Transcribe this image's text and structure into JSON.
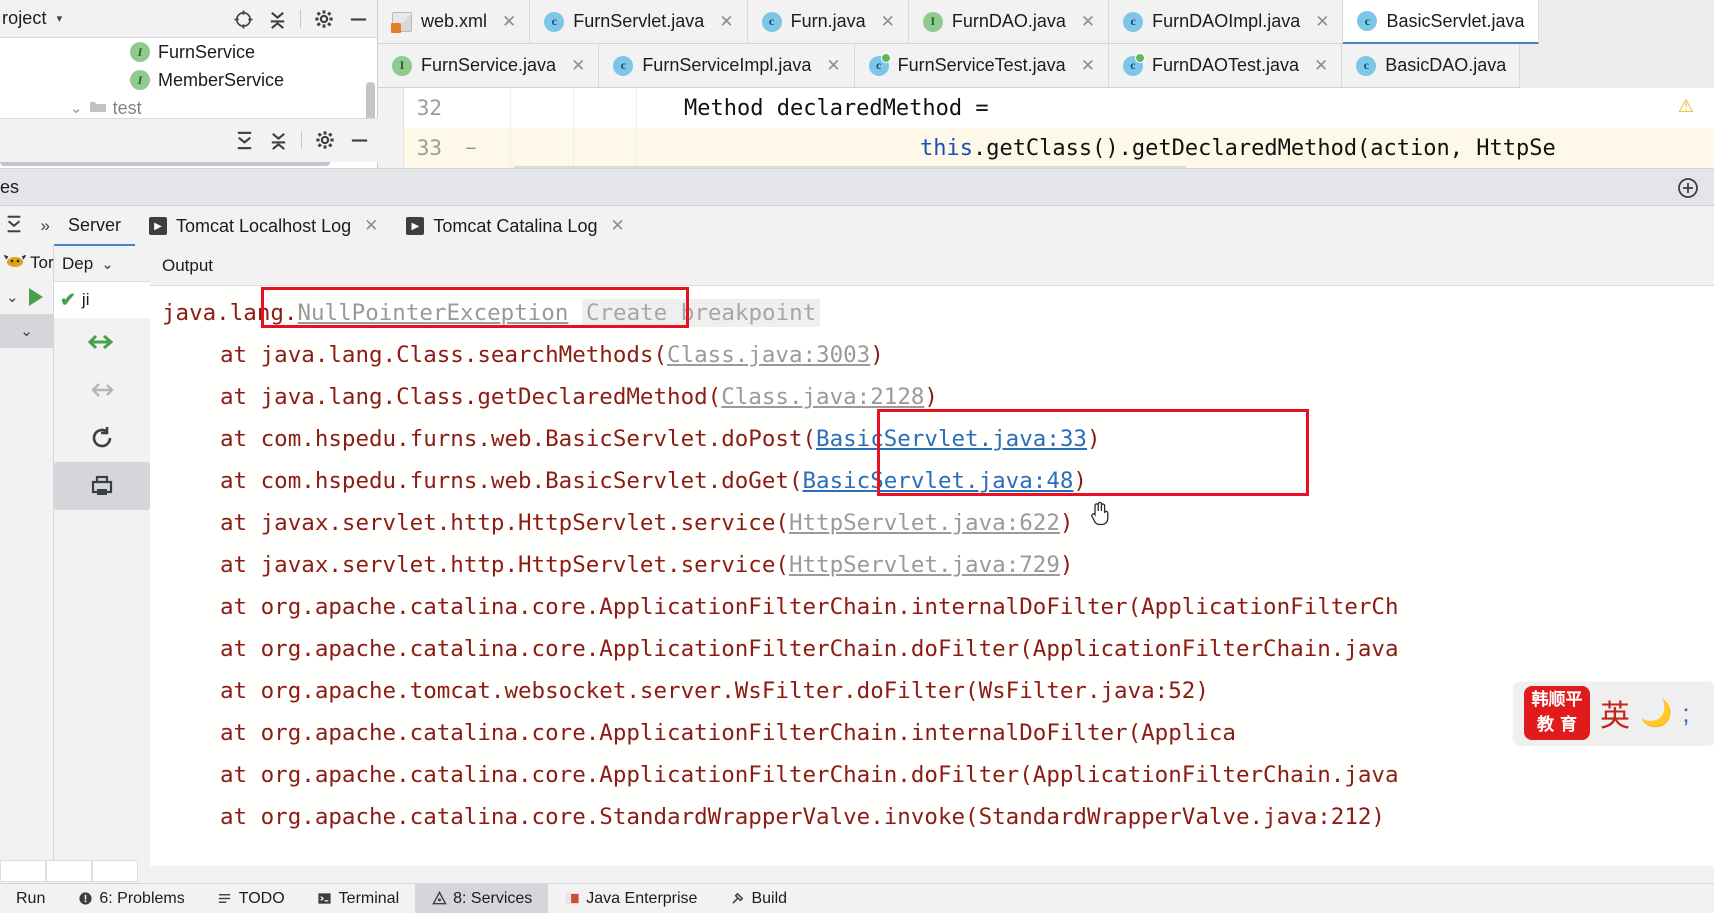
{
  "project_panel": {
    "title": "roject",
    "caret": "▾",
    "icons": [
      "locate-icon",
      "collapse-all-icon",
      "settings-gear-icon",
      "minimize-icon"
    ],
    "tree_items": [
      {
        "label": "FurnService",
        "icon": "interface-icon"
      },
      {
        "label": "MemberService",
        "icon": "interface-icon"
      },
      {
        "label": "test",
        "icon": "folder-icon"
      }
    ]
  },
  "structure_panel": {
    "icons": [
      "expand-all-icon",
      "collapse-all-icon",
      "settings-gear-icon",
      "minimize-icon"
    ]
  },
  "editor_tabs": {
    "row1": [
      {
        "label": "web.xml",
        "icon": "xml-file-icon",
        "active": false,
        "closable": true
      },
      {
        "label": "FurnServlet.java",
        "icon": "class-icon",
        "active": false,
        "closable": true
      },
      {
        "label": "Furn.java",
        "icon": "class-icon",
        "active": false,
        "closable": true
      },
      {
        "label": "FurnDAO.java",
        "icon": "interface-icon",
        "active": false,
        "closable": true
      },
      {
        "label": "FurnDAOImpl.java",
        "icon": "class-icon",
        "active": false,
        "closable": true
      },
      {
        "label": "BasicServlet.java",
        "icon": "class-icon",
        "active": true,
        "closable": false
      }
    ],
    "row2": [
      {
        "label": "FurnService.java",
        "icon": "interface-icon",
        "active": false,
        "closable": true
      },
      {
        "label": "FurnServiceImpl.java",
        "icon": "class-icon",
        "active": false,
        "closable": true
      },
      {
        "label": "FurnServiceTest.java",
        "icon": "test-class-icon",
        "active": false,
        "closable": true
      },
      {
        "label": "FurnDAOTest.java",
        "icon": "test-class-icon",
        "active": false,
        "closable": true
      },
      {
        "label": "BasicDAO.java",
        "icon": "class-icon",
        "active": false,
        "closable": false
      }
    ]
  },
  "editor": {
    "lines": [
      {
        "number": "32",
        "text": "Method declaredMethod =",
        "highlighted": false
      },
      {
        "number": "33",
        "text_pre": "",
        "keyword": "this",
        "text": ".getClass().getDeclaredMethod(action, HttpSe",
        "highlighted": true
      }
    ],
    "warning_icon": "warning-triangle-icon"
  },
  "services_band": {
    "title": "es",
    "right_icon": "add-service-icon"
  },
  "console_tabs": [
    {
      "label": "Server",
      "icon": null,
      "active": true,
      "closable": false
    },
    {
      "label": "Tomcat Localhost Log",
      "icon": "run-icon",
      "active": false,
      "closable": true
    },
    {
      "label": "Tomcat Catalina Log",
      "icon": "run-icon",
      "active": false,
      "closable": true
    }
  ],
  "run_rail": {
    "server_label": "Tor",
    "icons": [
      "tomcat-icon",
      "expand-chevron-icon",
      "run-play-icon",
      "chevron-down-icon"
    ]
  },
  "console_gutter": {
    "dropdown_label": "Dep",
    "dropdown_caret": "⌄",
    "status_label": "ji",
    "status_icon": "check-green-icon",
    "buttons": [
      "soft-wrap-icon",
      "scroll-to-end-icon",
      "rerun-icon",
      "print-icon"
    ]
  },
  "console": {
    "output_tab_label": "Output",
    "stack_trace": [
      {
        "indent": 0,
        "prefix": "java.lang.",
        "link": "NullPointerException",
        "link_style": "grey",
        "suffix": " ",
        "hint": "Create breakpoint"
      },
      {
        "indent": 1,
        "prefix": "at java.lang.Class.searchMethods(",
        "link": "Class.java:3003",
        "link_style": "grey",
        "suffix": ")"
      },
      {
        "indent": 1,
        "prefix": "at java.lang.Class.getDeclaredMethod(",
        "link": "Class.java:2128",
        "link_style": "grey",
        "suffix": ")"
      },
      {
        "indent": 1,
        "prefix": "at com.hspedu.furns.web.BasicServlet.doPost(",
        "link": "BasicServlet.java:33",
        "link_style": "blue",
        "suffix": ")"
      },
      {
        "indent": 1,
        "prefix": "at com.hspedu.furns.web.BasicServlet.doGet(",
        "link": "BasicServlet.java:48",
        "link_style": "blue",
        "suffix": ")"
      },
      {
        "indent": 1,
        "prefix": "at javax.servlet.http.HttpServlet.service(",
        "link": "HttpServlet.java:622",
        "link_style": "grey",
        "suffix": ")"
      },
      {
        "indent": 1,
        "prefix": "at javax.servlet.http.HttpServlet.service(",
        "link": "HttpServlet.java:729",
        "link_style": "grey",
        "suffix": ")"
      },
      {
        "indent": 1,
        "prefix": "at org.apache.catalina.core.ApplicationFilterChain.internalDoFilter(ApplicationFilterCh",
        "link": "",
        "link_style": "none",
        "suffix": ""
      },
      {
        "indent": 1,
        "prefix": "at org.apache.catalina.core.ApplicationFilterChain.doFilter(ApplicationFilterChain.java",
        "link": "",
        "link_style": "none",
        "suffix": ""
      },
      {
        "indent": 1,
        "prefix": "at org.apache.tomcat.websocket.server.WsFilter.doFilter(WsFilter.java:52)",
        "link": "",
        "link_style": "none",
        "suffix": ""
      },
      {
        "indent": 1,
        "prefix": "at org.apache.catalina.core.ApplicationFilterChain.internalDoFilter(Applica",
        "link": "",
        "link_style": "none",
        "suffix": ""
      },
      {
        "indent": 1,
        "prefix": "at org.apache.catalina.core.ApplicationFilterChain.doFilter(ApplicationFilterChain.java",
        "link": "",
        "link_style": "none",
        "suffix": ""
      },
      {
        "indent": 1,
        "prefix": "at org.apache.catalina.core.StandardWrapperValve.invoke(StandardWrapperValve.java:212)",
        "link": "",
        "link_style": "none",
        "suffix": ""
      }
    ]
  },
  "ime_widget": {
    "logo_line1": "韩顺平",
    "logo_line2": "教 育",
    "mode": "英",
    "moon_icon": "moon-icon",
    "semicolon": ";"
  },
  "status_bar": [
    {
      "label": "Run",
      "icon": null,
      "selected": false
    },
    {
      "label": "6: Problems",
      "icon": "problems-icon",
      "selected": false
    },
    {
      "label": "TODO",
      "icon": "todo-icon",
      "selected": false
    },
    {
      "label": "Terminal",
      "icon": "terminal-icon",
      "selected": false
    },
    {
      "label": "8: Services",
      "icon": "services-icon",
      "selected": true
    },
    {
      "label": "Java Enterprise",
      "icon": "java-ee-icon",
      "selected": false
    },
    {
      "label": "Build",
      "icon": "build-hammer-icon",
      "selected": false
    }
  ],
  "colors": {
    "exception_red": "#8c1c13",
    "link_blue": "#2a6ebb",
    "link_grey": "#9a9a9a",
    "annotation_red": "#e81123",
    "accent_blue": "#4683c9",
    "ime_red": "#e11b1b"
  }
}
